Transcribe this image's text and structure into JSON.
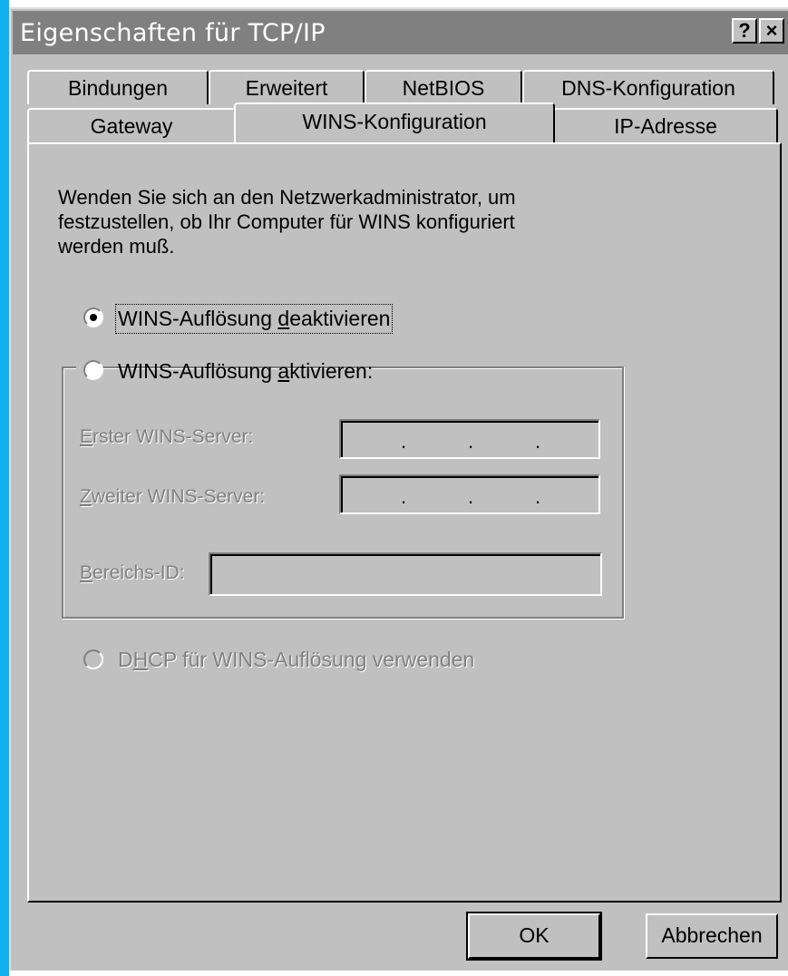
{
  "window": {
    "title": "Eigenschaften für TCP/IP",
    "help_button": "?",
    "close_button": "×"
  },
  "tabs_row_back": [
    {
      "label": "Bindungen"
    },
    {
      "label": "Erweitert"
    },
    {
      "label": "NetBIOS"
    },
    {
      "label": "DNS-Konfiguration"
    }
  ],
  "tabs_row_front": [
    {
      "label": "Gateway"
    },
    {
      "label": "WINS-Konfiguration",
      "active": true
    },
    {
      "label": "IP-Adresse"
    }
  ],
  "wins": {
    "description_lines": [
      "Wenden Sie sich an den Netzwerkadministrator, um",
      "festzustellen, ob Ihr Computer für WINS konfiguriert",
      "werden muß."
    ],
    "disable_option": {
      "label_pre": "WINS-Auflösung ",
      "label_underlined": "d",
      "label_post": "eaktivieren",
      "selected": true
    },
    "enable_option": {
      "label_pre": "WINS-Auflösung ",
      "label_underlined": "a",
      "label_post": "ktivieren:",
      "selected": false
    },
    "first_server": {
      "label_underlined": "E",
      "label_rest": "rster WINS-Server:",
      "value": ""
    },
    "second_server": {
      "label_underlined": "Z",
      "label_rest": "weiter WINS-Server:",
      "value": ""
    },
    "scope_id": {
      "label_underlined": "B",
      "label_rest": "ereichs-ID:",
      "value": ""
    },
    "dhcp_option": {
      "label_pre": "D",
      "label_underlined": "H",
      "label_post": "CP für WINS-Auflösung verwenden",
      "enabled": false
    }
  },
  "buttons": {
    "ok": "OK",
    "cancel": "Abbrechen"
  }
}
